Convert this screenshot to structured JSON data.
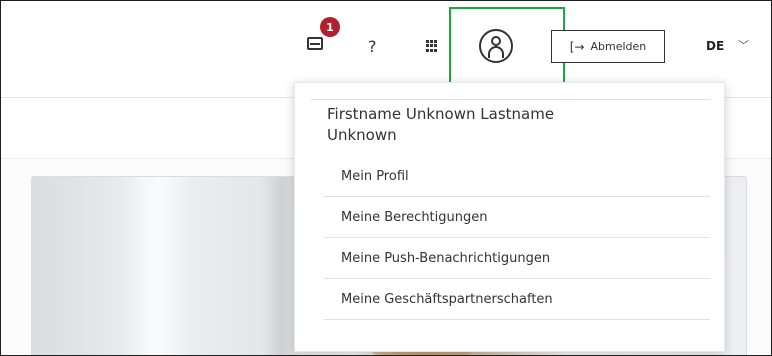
{
  "header": {
    "notification_count": "1",
    "help_label": "?",
    "logout_label": "Abmelden",
    "logout_icon": "[→",
    "language": "DE",
    "language_chevron": "﹀"
  },
  "user_menu": {
    "name": "Firstname Unknown Lastname Unknown",
    "items": [
      {
        "label": "Mein Profil"
      },
      {
        "label": "Meine Berechtigungen"
      },
      {
        "label": "Meine Push-Benachrichtigungen"
      },
      {
        "label": "Meine Geschäftspartnerschaften"
      }
    ]
  },
  "colors": {
    "badge": "#b21f2d",
    "highlight": "#1aab3a"
  },
  "icons": [
    "mail-icon",
    "help-icon",
    "apps-grid-icon",
    "user-icon",
    "logout-icon",
    "chevron-down-icon"
  ]
}
